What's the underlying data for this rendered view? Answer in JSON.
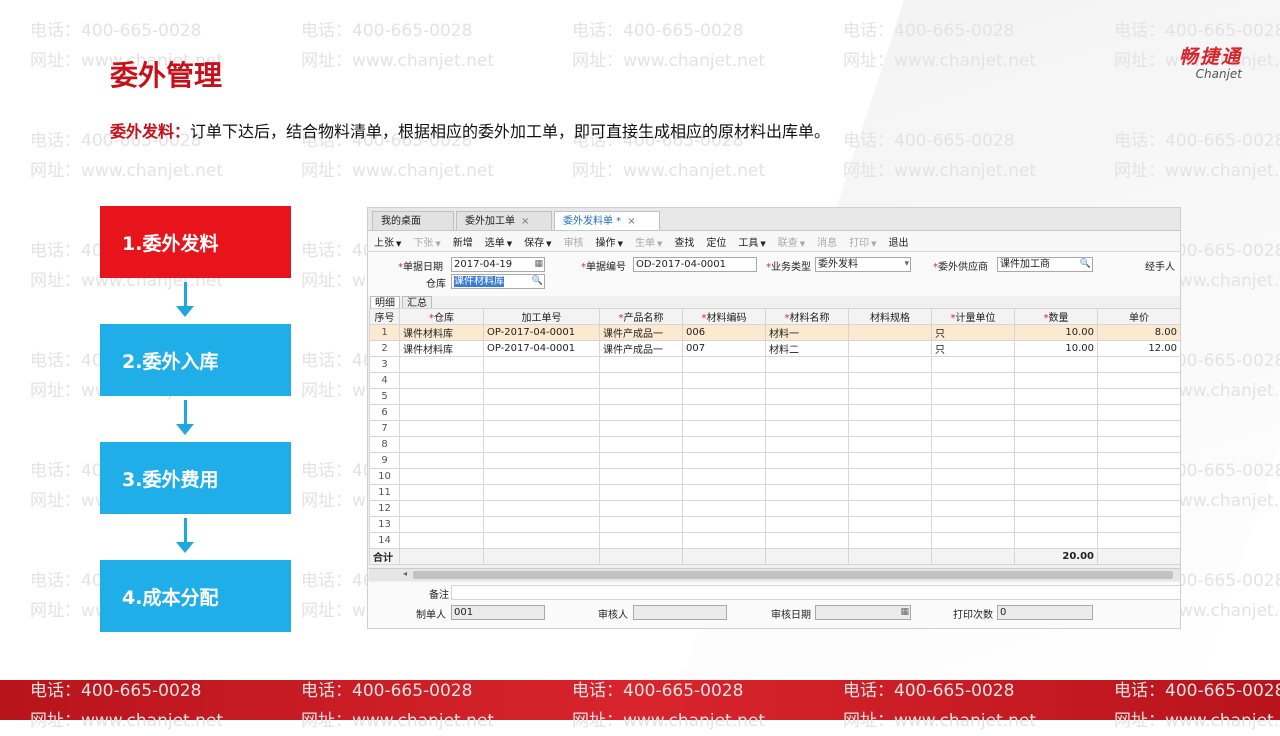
{
  "watermark": {
    "phone": "电话：400-665-0028",
    "site": "网址：www.chanjet.net"
  },
  "logo": {
    "cn": "畅捷通",
    "en": "Chanjet"
  },
  "title": "委外管理",
  "desc": {
    "highlight": "委外发料：",
    "text": "订单下达后，结合物料清单，根据相应的委外加工单，即可直接生成相应的原材料出库单。"
  },
  "steps": [
    {
      "label": "1.委外发料",
      "active": true
    },
    {
      "label": "2.委外入库",
      "active": false
    },
    {
      "label": "3.委外费用",
      "active": false
    },
    {
      "label": "4.成本分配",
      "active": false
    }
  ],
  "app": {
    "tabs": [
      {
        "label": "我的桌面"
      },
      {
        "label": "委外加工单"
      },
      {
        "label": "委外发料单 *"
      }
    ],
    "toolbar": [
      {
        "label": "上张"
      },
      {
        "label": "下张"
      },
      {
        "label": "新增"
      },
      {
        "label": "选单"
      },
      {
        "label": "保存"
      },
      {
        "label": "审核"
      },
      {
        "label": "操作"
      },
      {
        "label": "生单"
      },
      {
        "label": "查找"
      },
      {
        "label": "定位"
      },
      {
        "label": "工具"
      },
      {
        "label": "联查"
      },
      {
        "label": "消息"
      },
      {
        "label": "打印"
      },
      {
        "label": "退出"
      }
    ],
    "form": {
      "date_label": "单据日期",
      "date_value": "2017-04-19",
      "code_label": "单据编号",
      "code_value": "OD-2017-04-0001",
      "type_label": "业务类型",
      "type_value": "委外发料",
      "supplier_label": "委外供应商",
      "supplier_value": "课件加工商",
      "handler_label": "经手人",
      "warehouse_label": "仓库",
      "warehouse_value": "课件材料库"
    },
    "subtabs": [
      {
        "label": "明细"
      },
      {
        "label": "汇总"
      }
    ],
    "grid": {
      "columns": [
        "序号",
        "仓库",
        "加工单号",
        "产品名称",
        "材料编码",
        "材料名称",
        "材料规格",
        "计量单位",
        "数量",
        "单价"
      ],
      "rows": [
        {
          "no": "1",
          "warehouse": "课件材料库",
          "order": "OP-2017-04-0001",
          "product": "课件产成品一",
          "code": "006",
          "name": "材料一",
          "spec": "",
          "unit": "只",
          "qty": "10.00",
          "price": "8.00"
        },
        {
          "no": "2",
          "warehouse": "课件材料库",
          "order": "OP-2017-04-0001",
          "product": "课件产成品一",
          "code": "007",
          "name": "材料二",
          "spec": "",
          "unit": "只",
          "qty": "10.00",
          "price": "12.00"
        }
      ],
      "empty_rows": [
        "3",
        "4",
        "5",
        "6",
        "7",
        "8",
        "9",
        "10",
        "11",
        "12",
        "13",
        "14"
      ],
      "total_label": "合计",
      "total_qty": "20.00"
    },
    "footer": {
      "remark_label": "备注",
      "maker_label": "制单人",
      "maker_value": "001",
      "auditor_label": "审核人",
      "audit_date_label": "审核日期",
      "print_count_label": "打印次数",
      "print_count_value": "0"
    }
  }
}
